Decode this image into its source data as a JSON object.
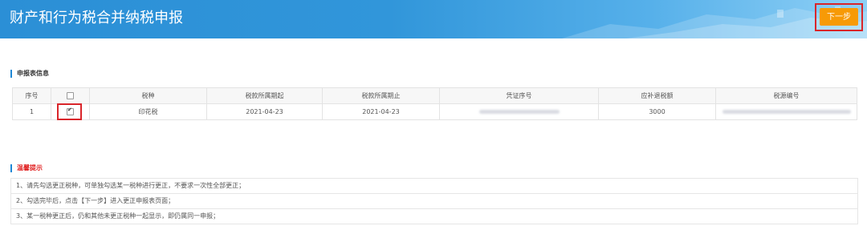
{
  "header": {
    "title": "财产和行为税合并纳税申报",
    "next_button": "下一步"
  },
  "declaration": {
    "section_title": "申报表信息",
    "columns": [
      "序号",
      "",
      "税种",
      "税款所属期起",
      "税款所属期止",
      "凭证序号",
      "应补退税额",
      "税源编号"
    ],
    "rows": [
      {
        "index": "1",
        "checked": true,
        "tax_type": "印花税",
        "period_start": "2021-04-23",
        "period_end": "2021-04-23",
        "voucher_no": "",
        "amount": "3000",
        "source_no": ""
      }
    ]
  },
  "tips": {
    "section_title": "温馨提示",
    "items": [
      "1、请先勾选更正税种，可单独勾选某一税种进行更正，不要求一次性全部更正；",
      "2、勾选完毕后，点击【下一步】进入更正申报表页面；",
      "3、某一税种更正后，仍和其他未更正税种一起显示，即仍属同一申报；"
    ]
  },
  "colors": {
    "header_blue": "#2b8fd6",
    "next_button": "#f79a06",
    "highlight_red": "#d9252a"
  }
}
